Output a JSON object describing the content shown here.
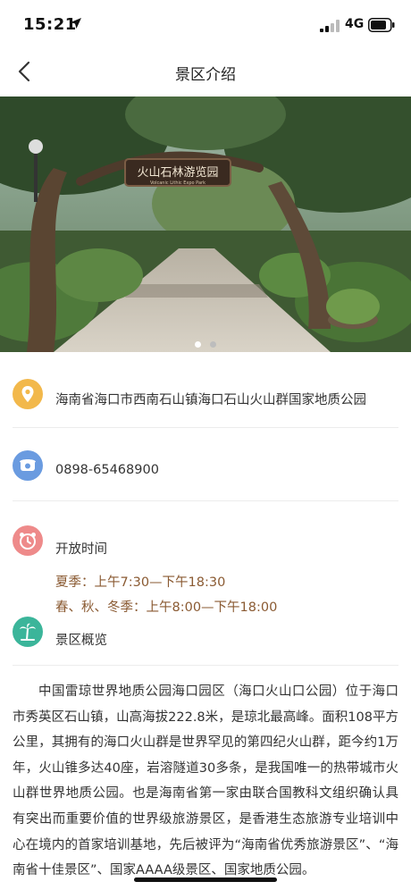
{
  "status_bar": {
    "time": "15:21",
    "network": "4G"
  },
  "nav": {
    "title": "景区介绍",
    "back_icon": "chevron-left-icon"
  },
  "hero": {
    "gate_sign": "火山石林游览园",
    "gate_sign_sub": "Volcanic Lithic Expo Park",
    "carousel_count": 2,
    "carousel_active": 1
  },
  "info": {
    "address": "海南省海口市西南石山镇海口石山火山群国家地质公园",
    "phone": "0898-65468900",
    "hours_label": "开放时间",
    "hours_summer": "夏季：上午7:30—下午18:30",
    "hours_other": "春、秋、冬季：上午8:00—下午18:00",
    "overview_label": "景区概览"
  },
  "icons": {
    "address": "location-pin-icon",
    "phone": "telephone-icon",
    "hours": "alarm-clock-icon",
    "overview": "palm-tree-icon"
  },
  "intro_text": "中国雷琼世界地质公园海口园区（海口火山口公园）位于海口市秀英区石山镇，山高海拔222.8米，是琼北最高峰。面积108平方公里，其拥有的海口火山群是世界罕见的第四纪火山群，距今约1万年，火山锥多达40座，岩溶隧道30多条，是我国唯一的热带城市火山群世界地质公园。也是海南省第一家由联合国教科文组织确认具有突出而重要价值的世界级旅游景区，是香港生态旅游专业培训中心在境内的首家培训基地，先后被评为“海南省优秀旅游景区”、“海南省十佳景区”、国家AAAA级景区、国家地质公园。",
  "colors": {
    "address_icon": "#f2b84b",
    "phone_icon": "#6a9be0",
    "hours_icon": "#ee8a8a",
    "overview_icon": "#3bb59a",
    "hours_text": "#8a5a32",
    "dot_active": "#ffffff",
    "dot_inactive": "#bdbdbd"
  }
}
